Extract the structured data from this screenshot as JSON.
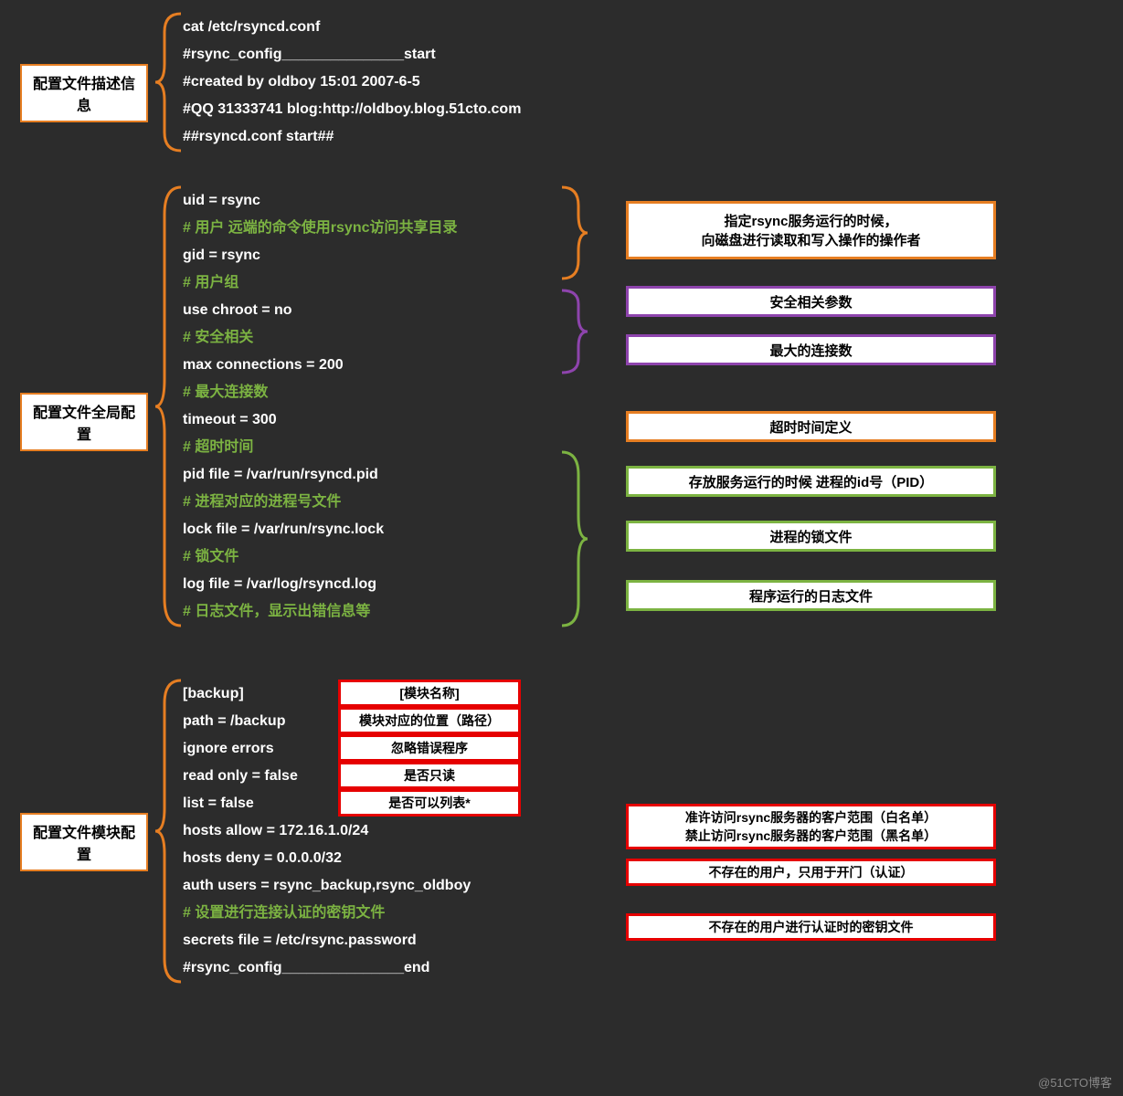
{
  "section1": {
    "label": "配置文件描述信息",
    "lines": [
      "cat /etc/rsyncd.conf",
      "#rsync_config_______________start",
      "#created by oldboy 15:01 2007-6-5",
      "#QQ 31333741 blog:http://oldboy.blog.51cto.com",
      "##rsyncd.conf start##"
    ]
  },
  "section2": {
    "label": "配置文件全局配置",
    "lines": [
      {
        "t": "uid = rsync",
        "c": false
      },
      {
        "t": "# 用户 远端的命令使用rsync访问共享目录",
        "c": true
      },
      {
        "t": "gid = rsync",
        "c": false
      },
      {
        "t": "# 用户组",
        "c": true
      },
      {
        "t": "use chroot = no",
        "c": false
      },
      {
        "t": "# 安全相关",
        "c": true
      },
      {
        "t": "max connections = 200",
        "c": false
      },
      {
        "t": "# 最大连接数",
        "c": true
      },
      {
        "t": "timeout = 300",
        "c": false
      },
      {
        "t": "# 超时时间",
        "c": true
      },
      {
        "t": "pid file = /var/run/rsyncd.pid",
        "c": false
      },
      {
        "t": "# 进程对应的进程号文件",
        "c": true
      },
      {
        "t": "lock file = /var/run/rsync.lock",
        "c": false
      },
      {
        "t": "# 锁文件",
        "c": true
      },
      {
        "t": "log file = /var/log/rsyncd.log",
        "c": false
      },
      {
        "t": "# 日志文件，显示出错信息等",
        "c": true
      }
    ],
    "notes": {
      "n1a": "指定rsync服务运行的时候，",
      "n1b": "向磁盘进行读取和写入操作的操作者",
      "n2": "安全相关参数",
      "n3": "最大的连接数",
      "n4": "超时时间定义",
      "n5": "存放服务运行的时候 进程的id号（PID）",
      "n6": "进程的锁文件",
      "n7": "程序运行的日志文件"
    }
  },
  "section3": {
    "label": "配置文件模块配置",
    "lines": [
      "[backup]",
      "path = /backup",
      "ignore errors",
      "read only = false",
      "list = false",
      "hosts allow = 172.16.1.0/24",
      "hosts deny = 0.0.0.0/32",
      "auth users = rsync_backup,rsync_oldboy",
      "# 设置进行连接认证的密钥文件",
      "secrets file = /etc/rsync.password",
      "#rsync_config_______________end"
    ],
    "tags": {
      "t1": "[模块名称]",
      "t2": "模块对应的位置（路径）",
      "t3": "忽略错误程序",
      "t4": "是否只读",
      "t5": "是否可以列表*"
    },
    "notes": {
      "r1a": "准许访问rsync服务器的客户范围（白名单）",
      "r1b": "禁止访问rsync服务器的客户范围（黑名单）",
      "r2": "不存在的用户，只用于开门（认证）",
      "r3": "不存在的用户进行认证时的密钥文件"
    }
  },
  "watermark": "@51CTO博客"
}
